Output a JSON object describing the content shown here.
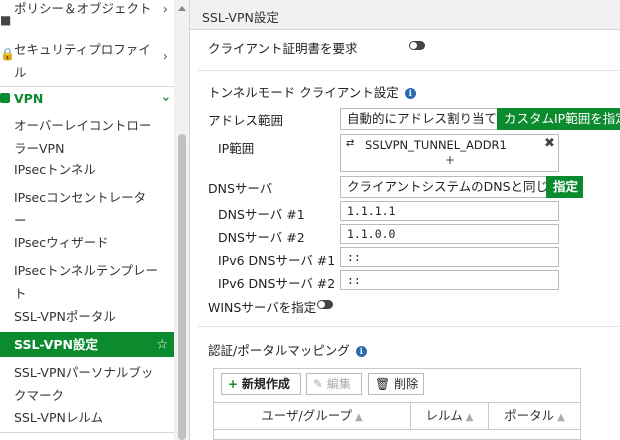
{
  "sidebar": {
    "items": [
      {
        "label": "ポリシー＆オブジェクト",
        "icon": "policy-icon"
      },
      {
        "label": "セキュリティプロファイル",
        "icon": "lock-icon"
      },
      {
        "label": "VPN",
        "icon": "vpn-icon"
      },
      {
        "label": "オーバーレイコントローラーVPN"
      },
      {
        "label": "IPsecトンネル"
      },
      {
        "label": "IPsecコンセントレーター"
      },
      {
        "label": "IPsecウィザード"
      },
      {
        "label": "IPsecトンネルテンプレート"
      },
      {
        "label": "SSL-VPNポータル"
      },
      {
        "label": "SSL-VPN設定"
      },
      {
        "label": "SSL-VPNパーソナルブックマーク"
      },
      {
        "label": "SSL-VPNレルム"
      }
    ],
    "active_color": "#0c8a2e",
    "vpn_color": "#0c8a2e"
  },
  "page": {
    "title": "SSL-VPN設定",
    "client_cert_label": "クライアント証明書を要求",
    "tunnel_section": "トンネルモード クライアント設定",
    "address_range_label": "アドレス範囲",
    "address_auto": "自動的にアドレス割り当て",
    "address_custom": "カスタムIP範囲を指定",
    "ip_range_label": "IP範囲",
    "ip_range_entry": "SSLVPN_TUNNEL_ADDR1",
    "ip_range_add": "+",
    "dns_label": "DNSサーバ",
    "dns_same": "クライアントシステムのDNSと同じ",
    "dns_specify": "指定",
    "dns1_label": "DNSサーバ #1",
    "dns1_value": "1.1.1.1",
    "dns2_label": "DNSサーバ #2",
    "dns2_value": "1.1.0.0",
    "ipv6dns1_label": "IPv6 DNSサーバ #1",
    "ipv6dns1_value": "::",
    "ipv6dns2_label": "IPv6 DNSサーバ #2",
    "ipv6dns2_value": "::",
    "wins_label": "WINSサーバを指定",
    "auth_section": "認証/ポータルマッピング",
    "new_button": "新規作成",
    "edit_button": "編集",
    "delete_button": "削除",
    "col_user_group": "ユーザ/グループ",
    "col_realm": "レルム",
    "col_portal": "ポータル",
    "accent_color": "#0c8a2e"
  }
}
